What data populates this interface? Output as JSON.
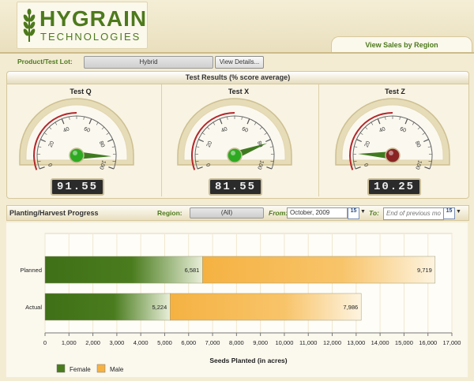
{
  "brand": {
    "name": "HYGRAIN",
    "subtitle": "TECHNOLOGIES"
  },
  "tab": {
    "label": "View Sales by Region"
  },
  "product": {
    "label": "Product/Test Lot:",
    "value": "Hybrid",
    "details_button": "View Details..."
  },
  "results": {
    "title": "Test Results (% score average)",
    "gauges": [
      {
        "title": "Test Q",
        "value": 91.55,
        "display": "91.55",
        "ticks": [
          "0",
          "20",
          "40",
          "60",
          "80",
          "100"
        ]
      },
      {
        "title": "Test X",
        "value": 81.55,
        "display": "81.55",
        "ticks": [
          "0",
          "20",
          "40",
          "60",
          "80",
          "100"
        ]
      },
      {
        "title": "Test Z",
        "value": 10.25,
        "display": "10.25",
        "ticks": [
          "0",
          "20",
          "40",
          "60",
          "80",
          "100"
        ]
      }
    ],
    "colors": {
      "needle": "#3f7a1f",
      "pivot_green": "#2eaa22",
      "pivot_red": "#8a2424",
      "red_arc": "#b3282d"
    }
  },
  "progress": {
    "title": "Planting/Harvest Progress",
    "region_label": "Region:",
    "region_value": "(All)",
    "from_label": "From:",
    "from_value": "October, 2009",
    "to_label": "To:",
    "to_placeholder": "End of previous mo",
    "calendar_label": "15"
  },
  "chart_data": {
    "type": "bar",
    "orientation": "horizontal",
    "stacked": true,
    "categories": [
      "Planned",
      "Actual"
    ],
    "series": [
      {
        "name": "Female",
        "values": [
          6581,
          5224
        ],
        "labels": [
          "6,581",
          "5,224"
        ],
        "color": "#4a7c1e"
      },
      {
        "name": "Male",
        "values": [
          9719,
          7986
        ],
        "labels": [
          "9,719",
          "7,986"
        ],
        "color": "#f5b242"
      }
    ],
    "xlabel": "Seeds Planted (in acres)",
    "xlim": [
      0,
      17000
    ],
    "xticks": [
      0,
      1000,
      2000,
      3000,
      4000,
      5000,
      6000,
      7000,
      8000,
      9000,
      10000,
      11000,
      12000,
      13000,
      14000,
      15000,
      16000,
      17000
    ],
    "xtick_labels": [
      "0",
      "1,000",
      "2,000",
      "3,000",
      "4,000",
      "5,000",
      "6,000",
      "7,000",
      "8,000",
      "9,000",
      "10,000",
      "11,000",
      "12,000",
      "13,000",
      "14,000",
      "15,000",
      "16,000",
      "17,000"
    ],
    "grid": true,
    "legend_position": "bottom-left"
  }
}
